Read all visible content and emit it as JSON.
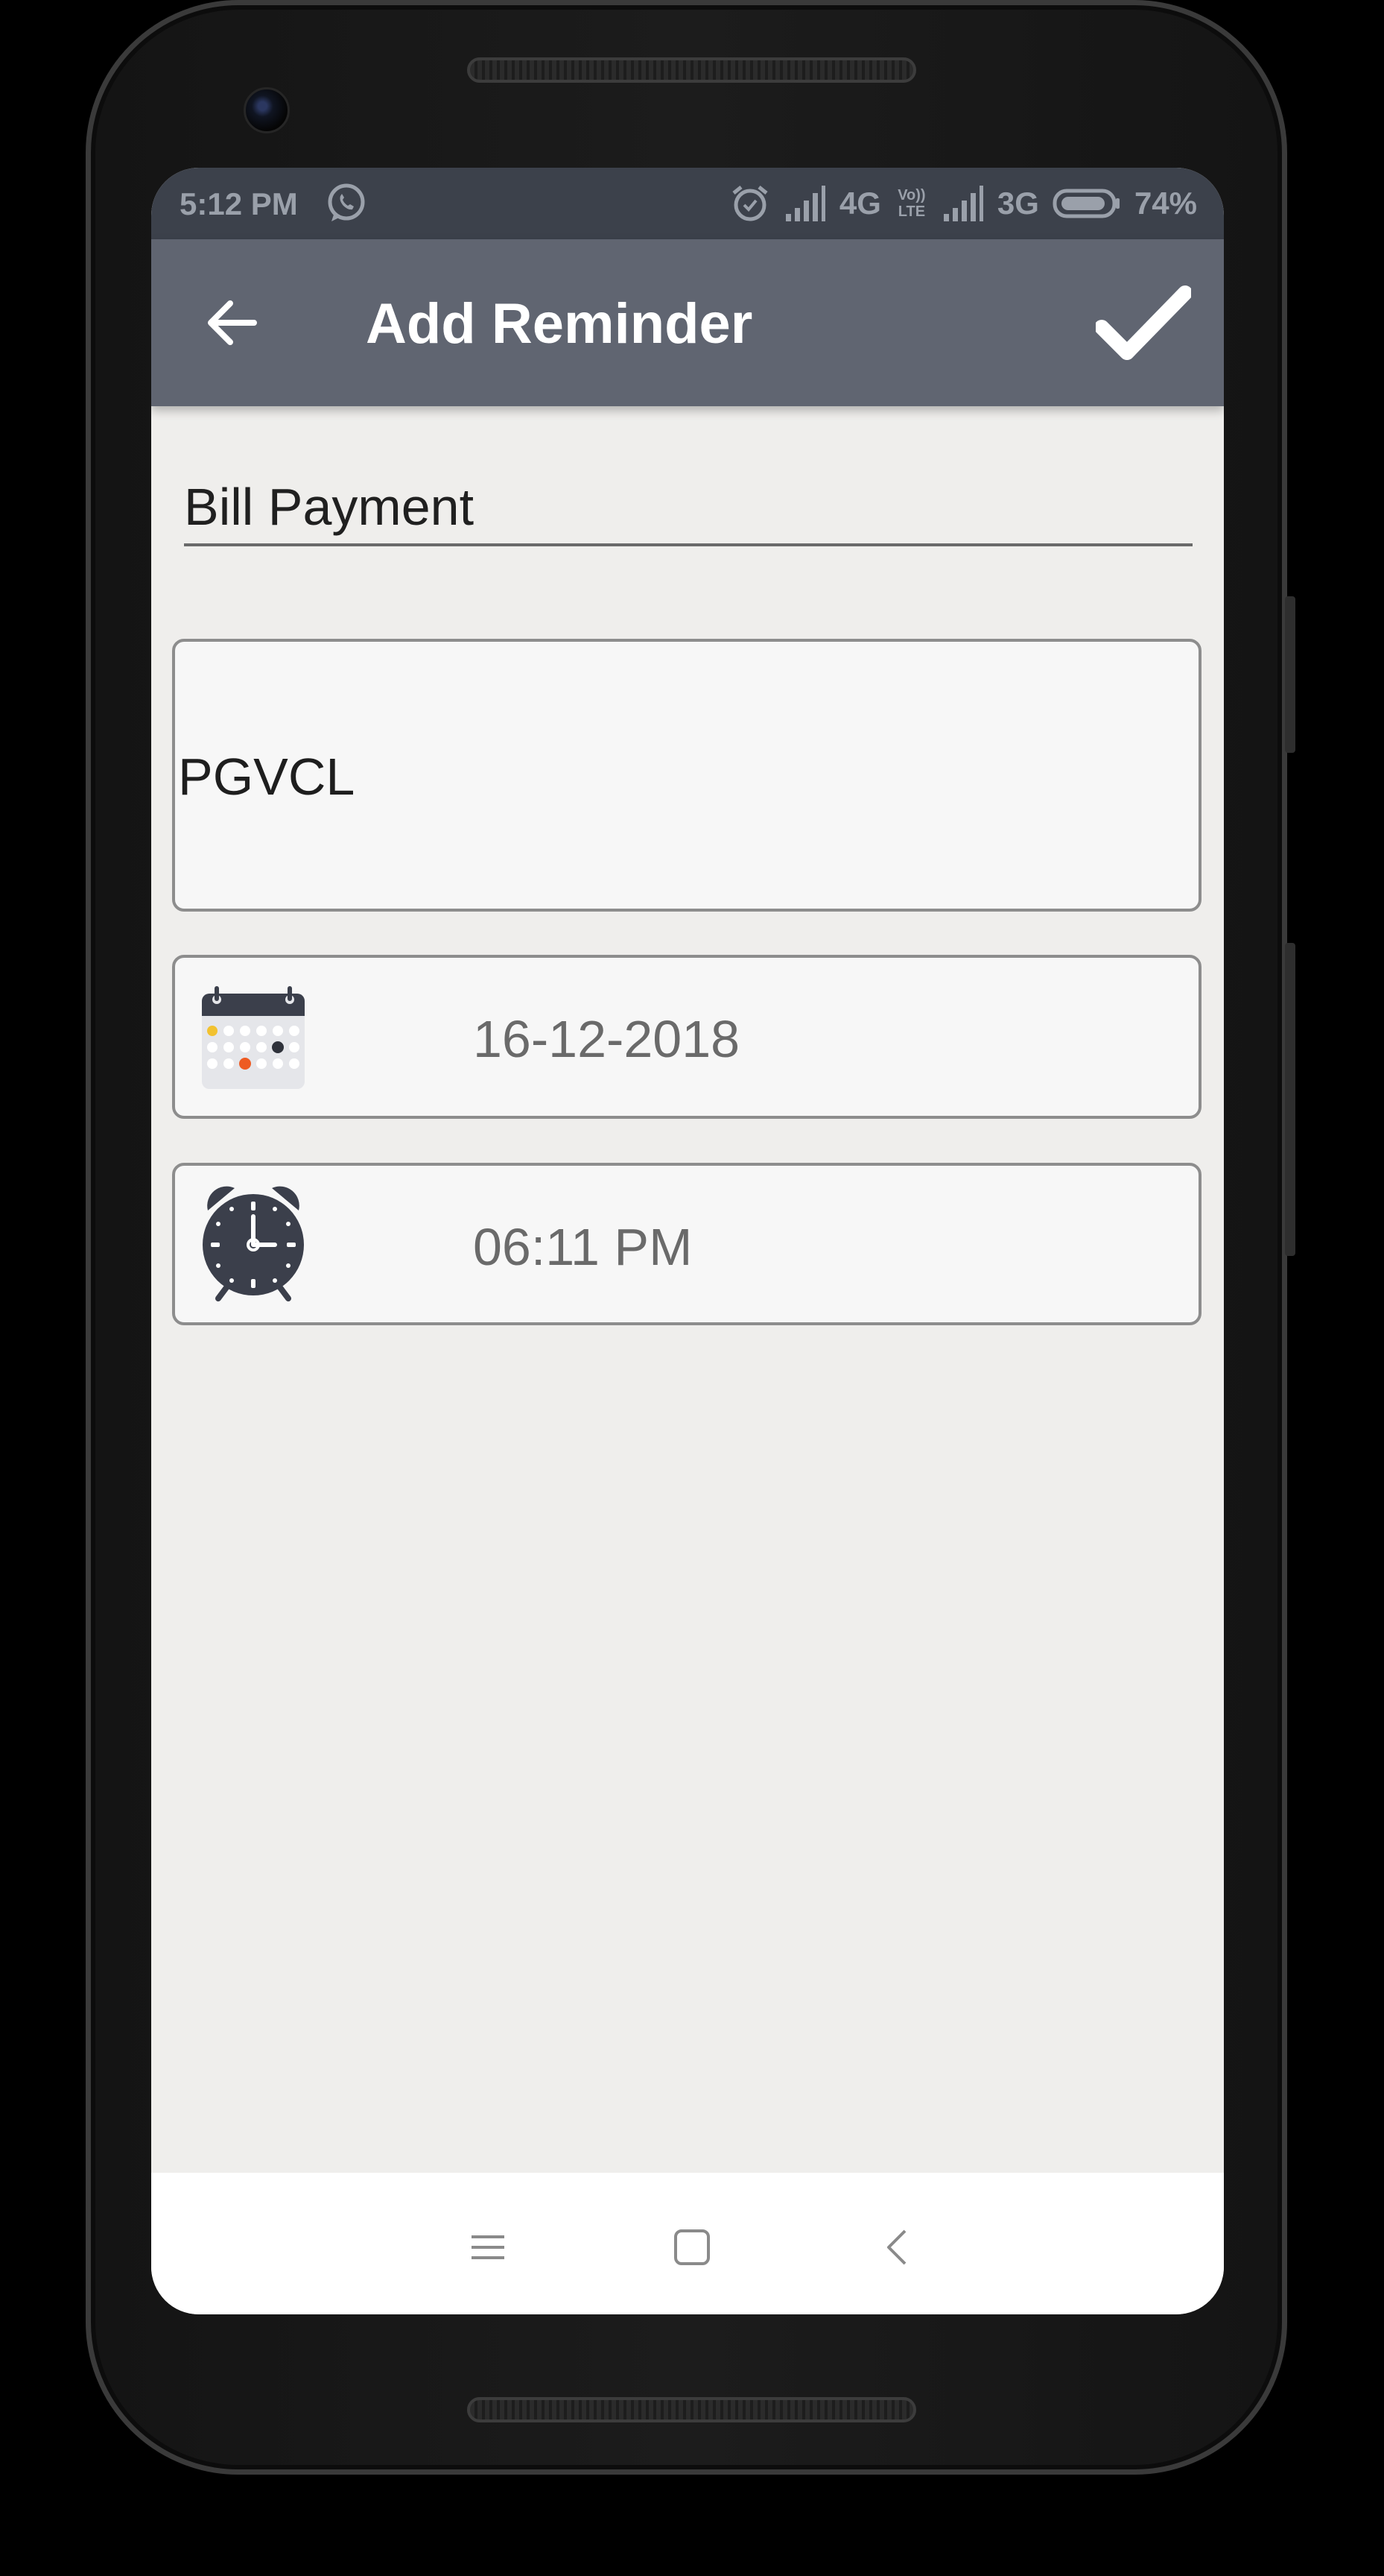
{
  "status_bar": {
    "time": "5:12 PM",
    "network_1": "4G",
    "network_2": "3G",
    "volte": "Vo)) LTE",
    "battery": "74%"
  },
  "app_bar": {
    "title": "Add Reminder",
    "back_icon": "arrow-left-icon",
    "confirm_icon": "check-icon"
  },
  "form": {
    "title_value": "Bill Payment",
    "description_value": "PGVCL",
    "date_value": "16-12-2018",
    "date_icon": "calendar-icon",
    "time_value": "06:11 PM",
    "time_icon": "alarm-clock-icon"
  },
  "nav_bar": {
    "menu_icon": "menu-icon",
    "home_icon": "home-square-icon",
    "back_icon": "chevron-left-icon"
  },
  "colors": {
    "status_bar": "#3c414b",
    "app_bar": "#606571",
    "background": "#efeeec"
  }
}
